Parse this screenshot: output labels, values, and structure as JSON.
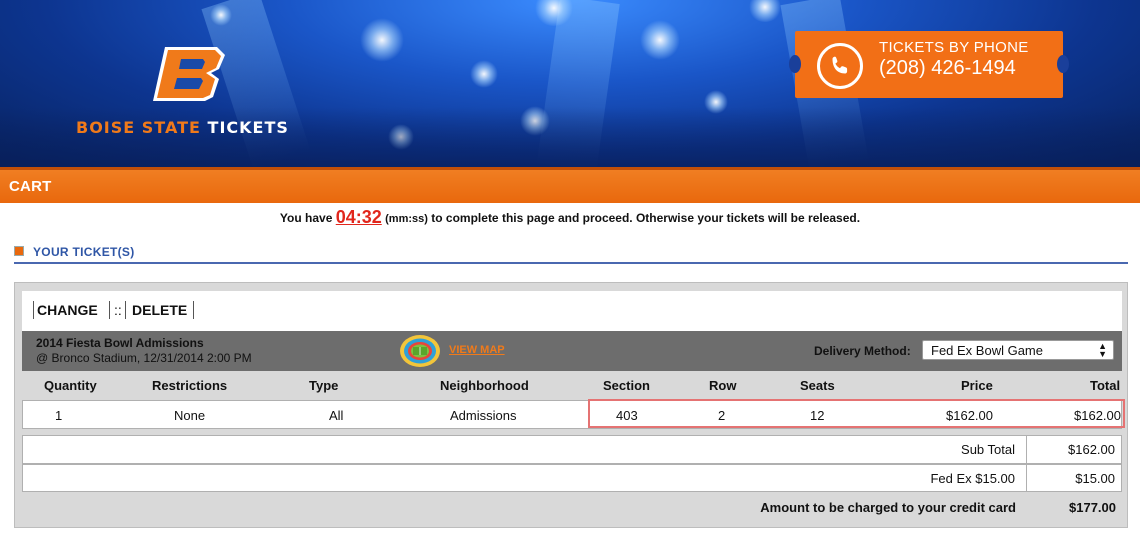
{
  "header": {
    "logo_letter": "B",
    "brand_part1": "BOISE STATE",
    "brand_part2": "TICKETS",
    "phone_label": "TICKETS BY PHONE",
    "phone_number": "(208) 426-1494",
    "colors": {
      "orange": "#f26f16",
      "blue": "#1a56c8"
    }
  },
  "cart_bar": {
    "title": "CART"
  },
  "timer": {
    "prefix": "You have",
    "value": "04:32",
    "unit": "(mm:ss)",
    "suffix": "to complete this page and proceed. Otherwise your tickets will be released."
  },
  "section": {
    "title": "YOUR TICKET(S)"
  },
  "actions": {
    "change": "CHANGE",
    "separator": "::",
    "delete": "DELETE"
  },
  "event": {
    "title": "2014 Fiesta Bowl Admissions",
    "venue_date": "@ Bronco Stadium, 12/31/2014 2:00 PM",
    "view_map": "VIEW MAP",
    "map_icon": "stadium-map-icon",
    "delivery_label": "Delivery Method:",
    "delivery_value": "Fed Ex Bowl Game"
  },
  "table": {
    "columns": [
      "Quantity",
      "Restrictions",
      "Type",
      "Neighborhood",
      "Section",
      "Row",
      "Seats",
      "Price",
      "Total"
    ],
    "row": {
      "quantity": "1",
      "restrictions": "None",
      "type": "All",
      "neighborhood": "Admissions",
      "section": "403",
      "row": "2",
      "seats": "12",
      "price": "$162.00",
      "total": "$162.00"
    }
  },
  "summary": {
    "subtotal_label": "Sub Total",
    "subtotal_value": "$162.00",
    "fee_label": "Fed Ex $15.00",
    "fee_value": "$15.00",
    "amount_label": "Amount to be charged to your credit card",
    "amount_value": "$177.00"
  }
}
